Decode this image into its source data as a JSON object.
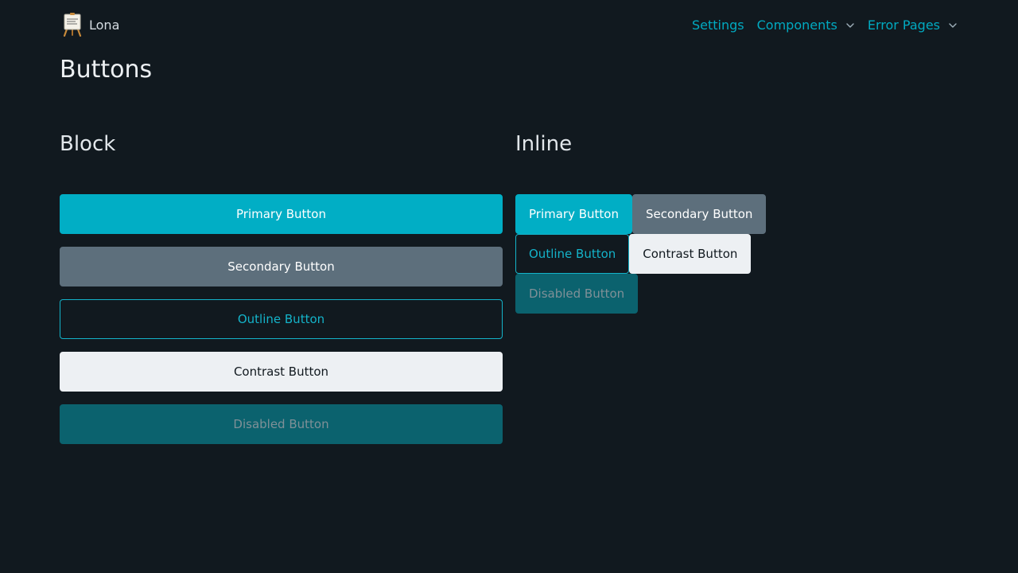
{
  "brand": {
    "name": "Lona",
    "logo_icon": "easel-logo-icon"
  },
  "nav": {
    "items": [
      {
        "label": "Settings",
        "has_dropdown": false
      },
      {
        "label": "Components",
        "has_dropdown": true
      },
      {
        "label": "Error Pages",
        "has_dropdown": true
      }
    ]
  },
  "page": {
    "title": "Buttons"
  },
  "sections": {
    "block": {
      "title": "Block",
      "buttons": {
        "primary": "Primary Button",
        "secondary": "Secondary Button",
        "outline": "Outline Button",
        "contrast": "Contrast Button",
        "disabled": "Disabled Button"
      }
    },
    "inline": {
      "title": "Inline",
      "buttons": {
        "primary": "Primary Button",
        "secondary": "Secondary Button",
        "outline": "Outline Button",
        "contrast": "Contrast Button",
        "disabled": "Disabled Button"
      }
    }
  },
  "colors": {
    "background": "#11191f",
    "accent": "#01aec5",
    "secondary": "#5d6f7c",
    "contrast": "#edf0f3",
    "disabled": "#0b626e"
  }
}
